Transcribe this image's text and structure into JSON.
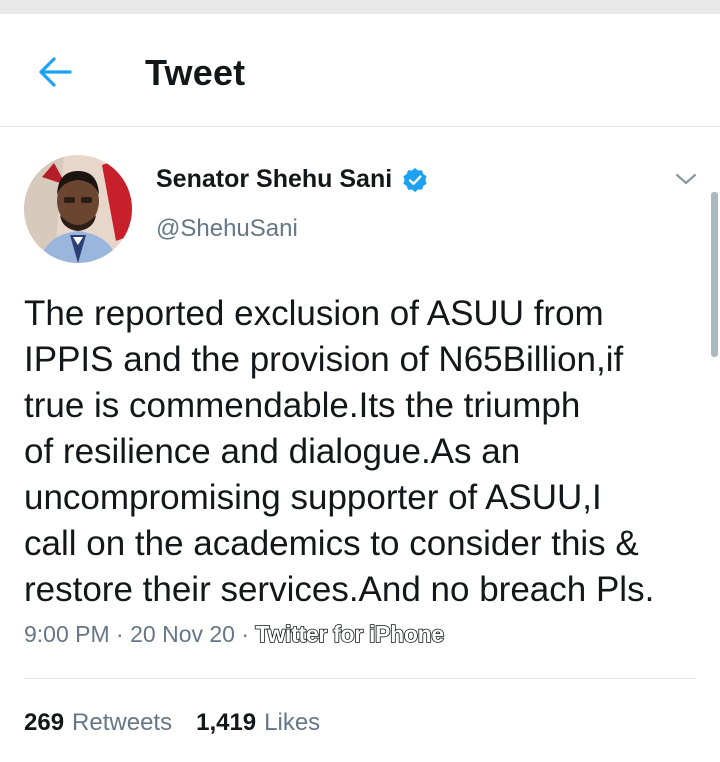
{
  "header": {
    "title": "Tweet"
  },
  "tweet": {
    "author_name": "Senator Shehu Sani",
    "author_handle": "@ShehuSani",
    "text": "The reported exclusion of ASUU from\nIPPIS and the provision of N65Billion,if\ntrue is commendable.Its the triumph\nof resilience and dialogue.As an\nuncompromising supporter of ASUU,I\ncall on the academics to consider this &\nrestore their services.And no breach Pls.",
    "time": "9:00 PM",
    "date": "20 Nov 20",
    "separator": " · ",
    "source": "Twitter for iPhone"
  },
  "stats": {
    "retweets_count": "269",
    "retweets_label": "Retweets",
    "likes_count": "1,419",
    "likes_label": "Likes"
  },
  "colors": {
    "accent": "#1da1f2",
    "secondary_text": "#657786",
    "divider": "#e1e8ed"
  },
  "icons": {
    "back": "back-arrow-icon",
    "verified": "verified-badge-icon",
    "more": "chevron-down-icon"
  }
}
